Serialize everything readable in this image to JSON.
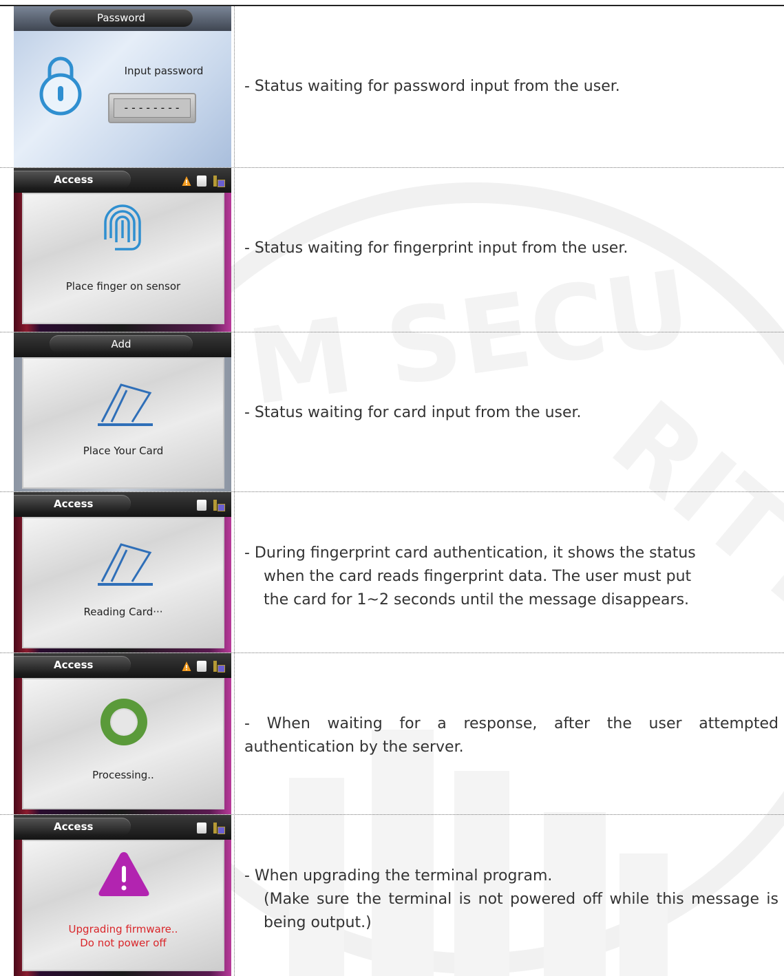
{
  "colors": {
    "error_text": "#d9262a",
    "fingerprint_blue": "#2f8fd0",
    "processing_green": "#5a9a3a",
    "warning_purple": "#b224b0"
  },
  "rows": [
    {
      "screen": {
        "title": "Password",
        "label": "Input password",
        "field_value": "--------",
        "icon": "lock-icon"
      },
      "description": "- Status waiting for password input from the user."
    },
    {
      "screen": {
        "title": "Access",
        "message": "Place finger on sensor",
        "icon": "fingerprint-icon",
        "status_icons": [
          "warning-icon",
          "card-icon",
          "network-icon"
        ]
      },
      "description": "- Status waiting for fingerprint input from the user."
    },
    {
      "screen": {
        "title": "Add",
        "message": "Place Your Card",
        "icon": "card-tap-icon"
      },
      "description": "- Status waiting for card input from the user."
    },
    {
      "screen": {
        "title": "Access",
        "message": "Reading Card···",
        "icon": "card-tap-icon",
        "status_icons": [
          "card-icon",
          "network-icon"
        ]
      },
      "description_lines": [
        "- During fingerprint card authentication, it shows the status",
        "when the card reads fingerprint data. The user must put",
        "the card for 1~2 seconds until the message disappears."
      ]
    },
    {
      "screen": {
        "title": "Access",
        "message": "Processing..",
        "icon": "processing-icon",
        "status_icons": [
          "warning-icon",
          "card-icon",
          "network-icon"
        ]
      },
      "description": "- When waiting for a response, after the user attempted authentication by the server."
    },
    {
      "screen": {
        "title": "Access",
        "message_lines": [
          "Upgrading firmware..",
          "Do not power off"
        ],
        "icon": "warning-triangle-icon",
        "status_icons": [
          "card-icon",
          "network-icon"
        ]
      },
      "description_lines": [
        "- When upgrading the terminal program.",
        "(Make sure the terminal is not powered off while this message is being output.)"
      ]
    }
  ]
}
